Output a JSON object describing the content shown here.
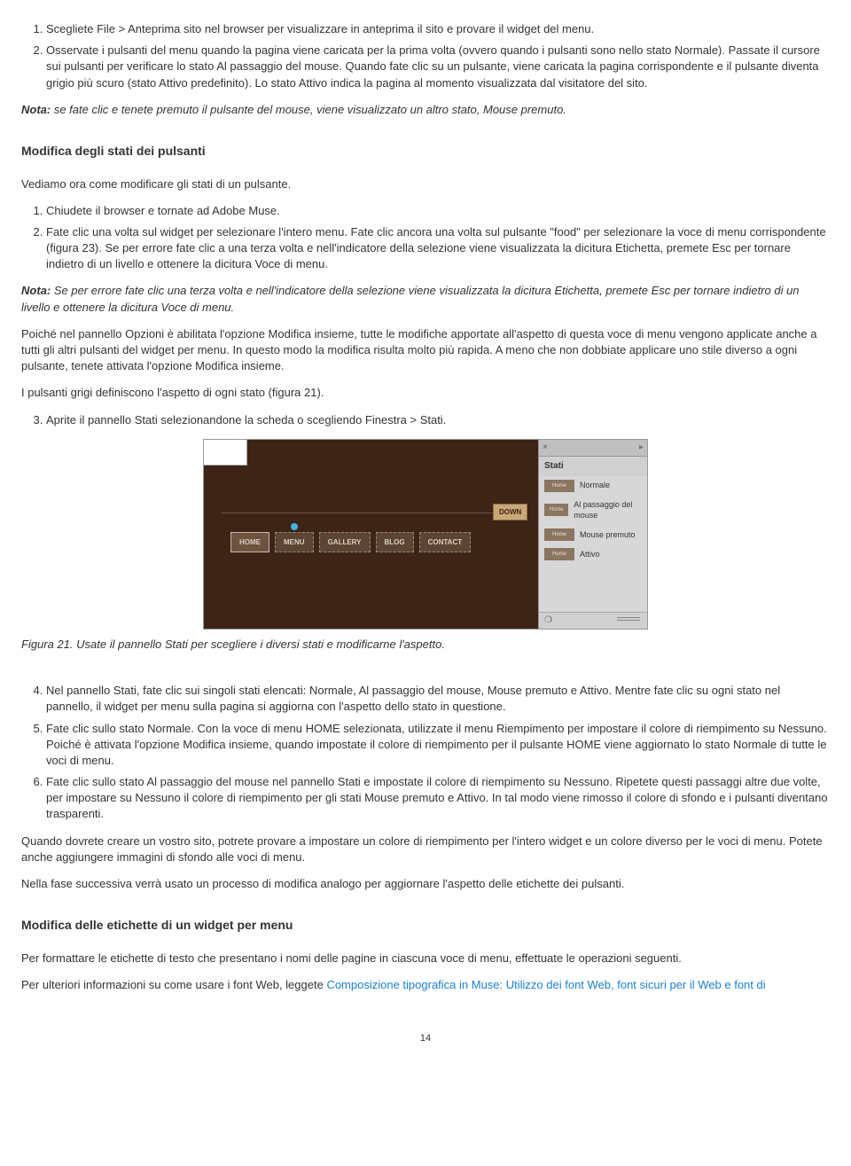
{
  "list1": {
    "item1": "Scegliete File > Anteprima sito nel browser per visualizzare in anteprima il sito e provare il widget del menu.",
    "item2": "Osservate i pulsanti del menu quando la pagina viene caricata per la prima volta (ovvero quando i pulsanti sono nello stato Normale). Passate il cursore sui pulsanti per verificare lo stato Al passaggio del mouse. Quando fate clic su un pulsante, viene caricata la pagina corrispondente e il pulsante diventa grigio più scuro (stato Attivo predefinito). Lo stato Attivo indica la pagina al momento visualizzata dal visitatore del sito."
  },
  "note1": {
    "label": "Nota:",
    "text": " se fate clic e tenete premuto il pulsante del mouse, viene visualizzato un altro stato, Mouse premuto."
  },
  "heading1": "Modifica degli stati dei pulsanti",
  "para1": "Vediamo ora come modificare gli stati di un pulsante.",
  "list2": {
    "item1": "Chiudete il browser e tornate ad Adobe Muse.",
    "item2": "Fate clic una volta sul widget per selezionare l'intero menu. Fate clic ancora una volta sul pulsante \"food\" per selezionare la voce di menu corrispondente (figura 23). Se per errore fate clic a una terza volta e nell'indicatore della selezione viene visualizzata la dicitura Etichetta, premete Esc per tornare indietro di un livello e ottenere la dicitura Voce di menu."
  },
  "note2": {
    "label": "Nota:",
    "text": " Se per errore fate clic una terza volta e nell'indicatore della selezione viene visualizzata la dicitura Etichetta, premete Esc per tornare indietro di un livello e ottenere la dicitura Voce di menu."
  },
  "para2": "Poiché nel pannello Opzioni è abilitata l'opzione Modifica insieme, tutte le modifiche apportate all'aspetto di questa voce di menu vengono applicate anche a tutti gli altri pulsanti del widget per menu. In questo modo la modifica risulta molto più rapida. A meno che non dobbiate applicare uno stile diverso a ogni pulsante, tenete attivata l'opzione Modifica insieme.",
  "para3": "I pulsanti grigi definiscono l'aspetto di ogni stato (figura 21).",
  "list3": {
    "item3": "Aprite il pannello Stati selezionandone la scheda o scegliendo Finestra > Stati."
  },
  "figure": {
    "ribbon": "DOWN",
    "nav": {
      "n1": "HOME",
      "n2": "MENU",
      "n3": "GALLERY",
      "n4": "BLOG",
      "n5": "CONTACT"
    },
    "panel": {
      "title": "Stati",
      "thumb": "Home",
      "s1": "Normale",
      "s2": "Al passaggio del mouse",
      "s3": "Mouse premuto",
      "s4": "Attivo"
    }
  },
  "caption": "Figura 21. Usate il pannello Stati per scegliere i diversi stati e modificarne l'aspetto.",
  "list4": {
    "item4": "Nel pannello Stati, fate clic sui singoli stati elencati: Normale, Al passaggio del mouse, Mouse premuto e Attivo. Mentre fate clic su ogni stato nel pannello, il widget per menu sulla pagina si aggiorna con l'aspetto dello stato in questione.",
    "item5": "Fate clic sullo stato Normale. Con la voce di menu HOME selezionata, utilizzate il menu Riempimento per impostare il colore di riempimento su Nessuno. Poiché è attivata l'opzione Modifica insieme, quando impostate il colore di riempimento per il pulsante HOME viene aggiornato lo stato Normale di tutte le voci di menu.",
    "item6": "Fate clic sullo stato Al passaggio del mouse nel pannello Stati e impostate il colore di riempimento su Nessuno. Ripetete questi passaggi altre due volte, per impostare su Nessuno il colore di riempimento per gli stati Mouse premuto e Attivo. In tal modo viene rimosso il colore di sfondo e i pulsanti diventano trasparenti."
  },
  "para4": "Quando dovrete creare un vostro sito, potrete provare a impostare un colore di riempimento per l'intero widget e un colore diverso per le voci di menu. Potete anche aggiungere immagini di sfondo alle voci di menu.",
  "para5": "Nella fase successiva verrà usato un processo di modifica analogo per aggiornare l'aspetto delle etichette dei pulsanti.",
  "heading2": "Modifica delle etichette di un widget per menu",
  "para6": "Per formattare le etichette di testo che presentano i nomi delle pagine in ciascuna voce di menu, effettuate le operazioni seguenti.",
  "para7a": "Per ulteriori informazioni su come usare i font Web, leggete ",
  "link1": "Composizione tipografica in Muse: Utilizzo dei font Web, font sicuri per il Web e font di",
  "pagenum": "14"
}
